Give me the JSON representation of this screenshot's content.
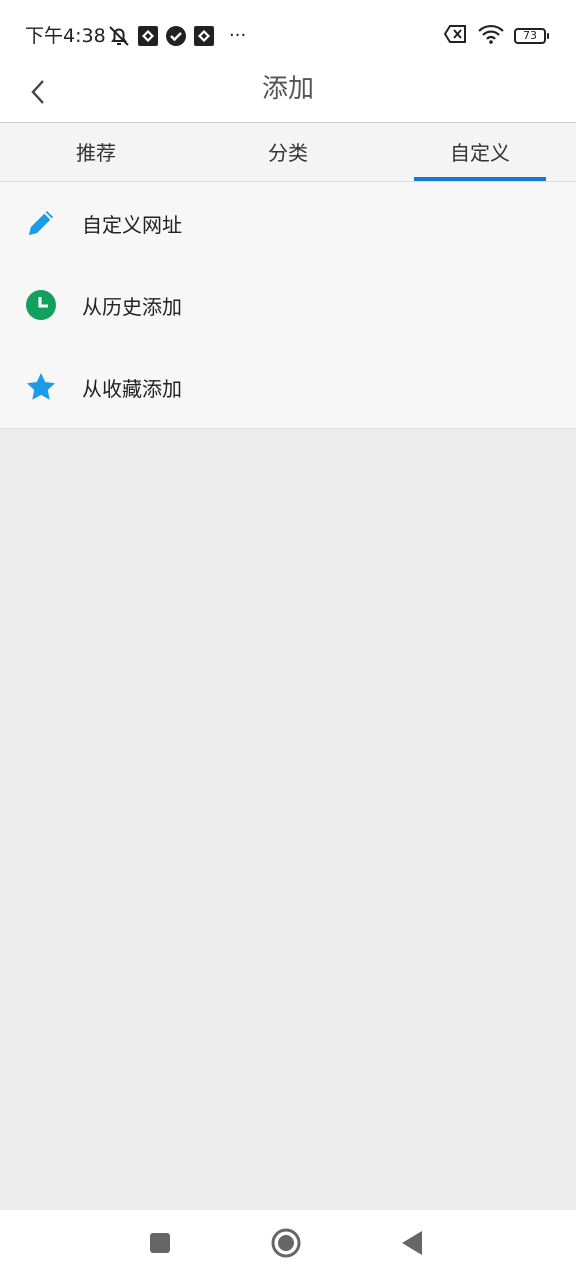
{
  "status_bar": {
    "time": "下午4:38",
    "more": "···",
    "battery_level": "73",
    "icons": [
      "mute-icon",
      "app-notification-icon",
      "check-badge-icon",
      "app-notification-icon",
      "sim-disabled-icon",
      "wifi-icon",
      "battery-icon"
    ]
  },
  "header": {
    "title": "添加",
    "back_icon": "chevron-left-icon"
  },
  "tabs": [
    {
      "label": "推荐",
      "active": false
    },
    {
      "label": "分类",
      "active": false
    },
    {
      "label": "自定义",
      "active": true
    }
  ],
  "list": {
    "items": [
      {
        "label": "自定义网址",
        "icon": "pencil-icon",
        "icon_color": "#1e9be6"
      },
      {
        "label": "从历史添加",
        "icon": "clock-icon",
        "icon_color": "#12a05c"
      },
      {
        "label": "从收藏添加",
        "icon": "star-icon",
        "icon_color": "#1e9be6"
      }
    ]
  },
  "colors": {
    "accent": "#1a78d6",
    "background": "#ececec"
  },
  "nav_bar": {
    "icons": [
      "recents-square-icon",
      "home-circle-icon",
      "back-triangle-icon"
    ]
  }
}
